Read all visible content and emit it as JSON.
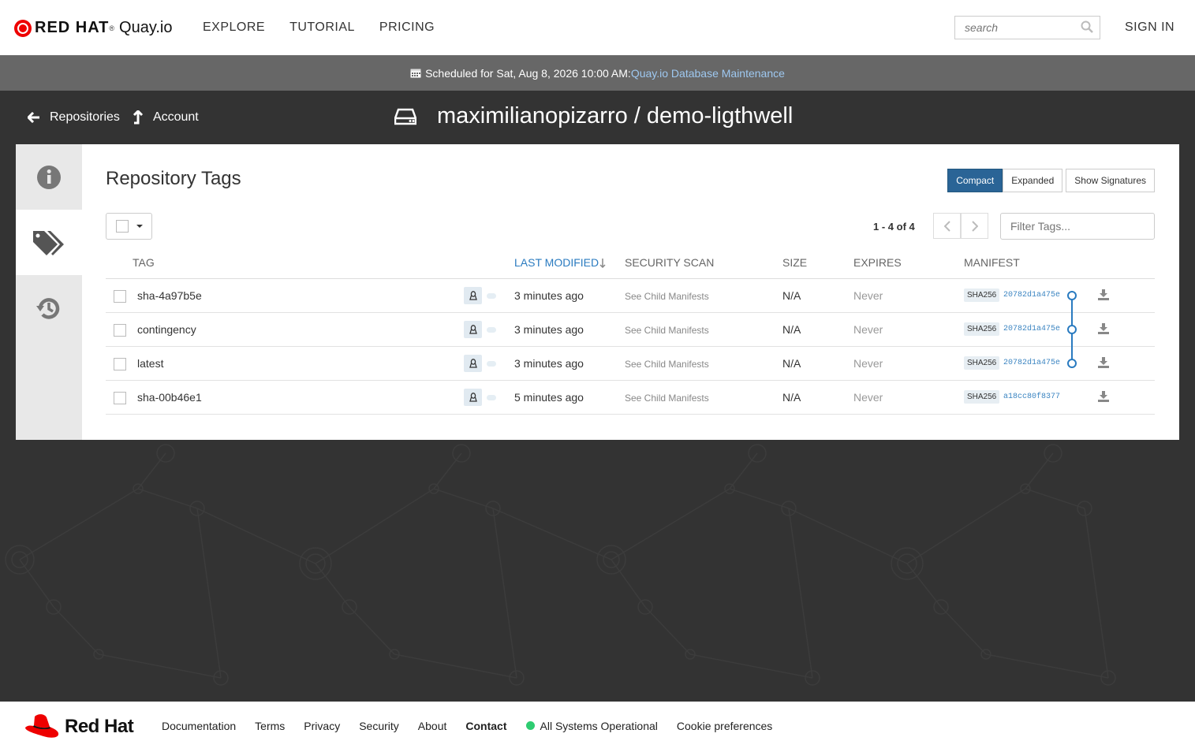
{
  "brand": {
    "name": "RED HAT",
    "reg": "®",
    "product": "Quay.io"
  },
  "nav": {
    "links": [
      "EXPLORE",
      "TUTORIAL",
      "PRICING"
    ],
    "signin": "SIGN IN"
  },
  "search": {
    "placeholder": "search"
  },
  "banner": {
    "text": "Scheduled for Sat, Aug 8, 2026 10:00 AM:",
    "link": "Quay.io Database Maintenance"
  },
  "breadcrumbs": {
    "repositories": "Repositories",
    "account": "Account"
  },
  "repo": {
    "title": "maximilianopizarro / demo-ligthwell"
  },
  "tags_section": {
    "title": "Repository Tags",
    "views": {
      "compact": "Compact",
      "expanded": "Expanded",
      "signatures": "Show Signatures"
    },
    "pager": {
      "count": "1 - 4 of 4"
    },
    "filter_placeholder": "Filter Tags...",
    "columns": {
      "tag": "TAG",
      "last_modified": "LAST MODIFIED",
      "security_scan": "SECURITY SCAN",
      "size": "SIZE",
      "expires": "EXPIRES",
      "manifest": "MANIFEST"
    },
    "rows": [
      {
        "tag": "sha-4a97b5e",
        "modified": "3 minutes ago",
        "scan": "See Child Manifests",
        "size": "N/A",
        "expires": "Never",
        "sha": "SHA256",
        "digest": "20782d1a475e"
      },
      {
        "tag": "contingency",
        "modified": "3 minutes ago",
        "scan": "See Child Manifests",
        "size": "N/A",
        "expires": "Never",
        "sha": "SHA256",
        "digest": "20782d1a475e"
      },
      {
        "tag": "latest",
        "modified": "3 minutes ago",
        "scan": "See Child Manifests",
        "size": "N/A",
        "expires": "Never",
        "sha": "SHA256",
        "digest": "20782d1a475e"
      },
      {
        "tag": "sha-00b46e1",
        "modified": "5 minutes ago",
        "scan": "See Child Manifests",
        "size": "N/A",
        "expires": "Never",
        "sha": "SHA256",
        "digest": "a18cc80f8377"
      }
    ]
  },
  "footer": {
    "logo": "Red Hat",
    "links": [
      "Documentation",
      "Terms",
      "Privacy",
      "Security",
      "About",
      "Contact"
    ],
    "status": "All Systems Operational",
    "cookie": "Cookie preferences"
  },
  "colors": {
    "accent": "#2a6496",
    "link": "#2a7bc0",
    "status_ok": "#2ecc71",
    "brand_red": "#ee0000"
  }
}
